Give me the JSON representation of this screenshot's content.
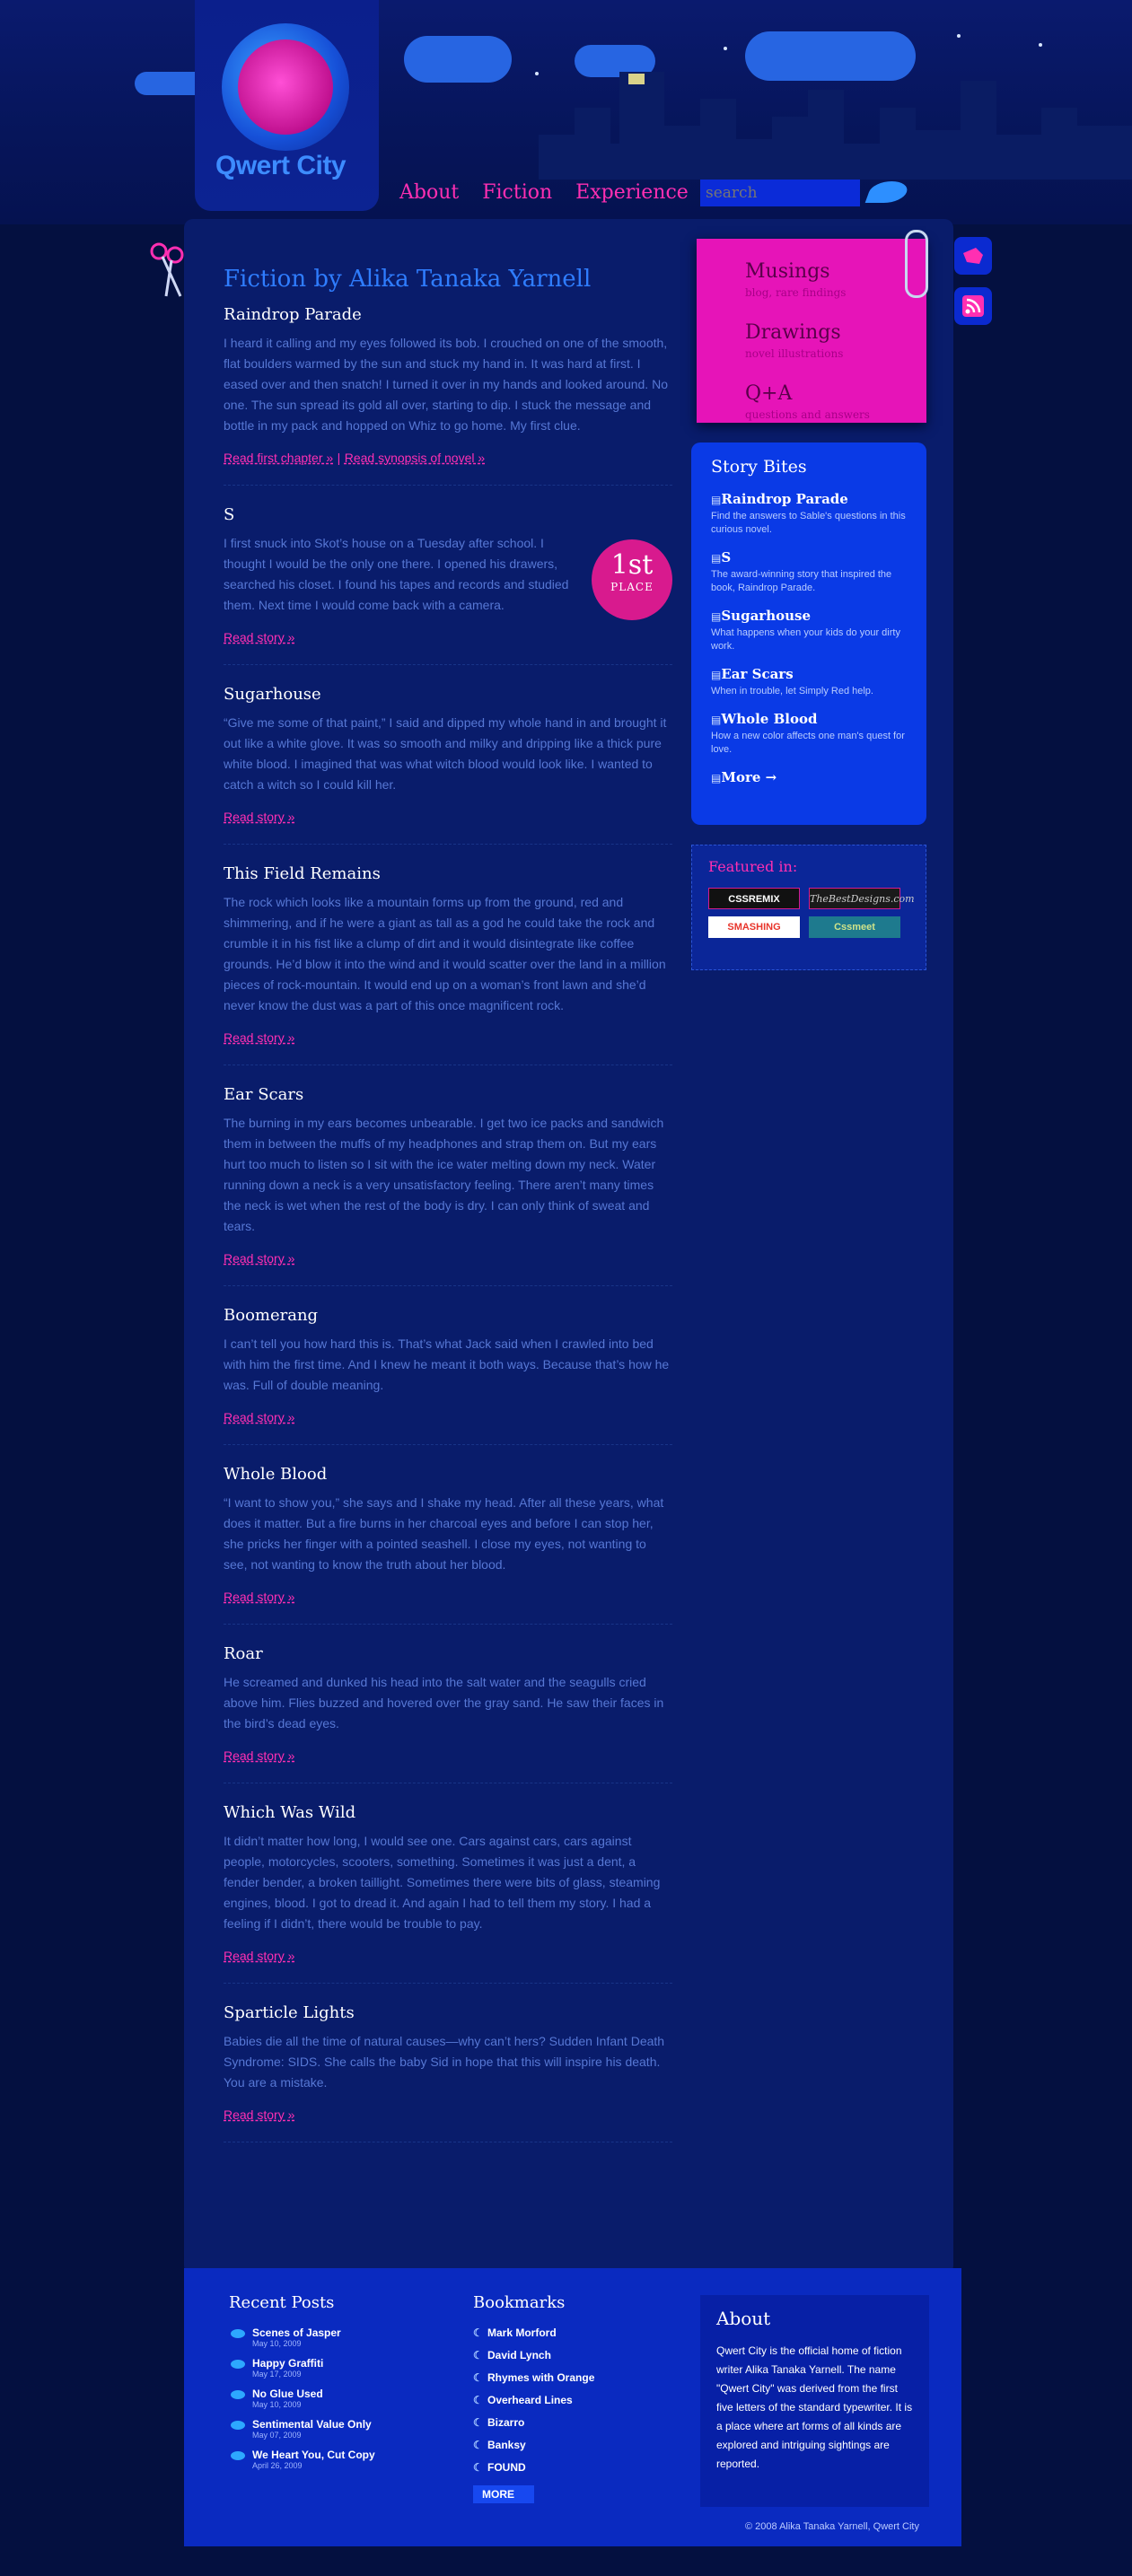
{
  "site": {
    "logo_text": "Qwert City"
  },
  "nav": {
    "items": [
      "About",
      "Fiction",
      "Experience"
    ],
    "search_placeholder": "search"
  },
  "page": {
    "title": "Fiction by Alika Tanaka Yarnell"
  },
  "stories": [
    {
      "title": "Raindrop Parade",
      "text": "I heard it calling and my eyes followed its bob. I crouched on one of the smooth, flat boulders warmed by the sun and stuck my hand in. It was hard at first. I eased over and then snatch! I turned it over in my hands and looked around. No one. The sun spread its gold all over, starting to dip. I stuck the message and bottle in my pack and hopped on Whiz to go home. My first clue.",
      "link": "Read first chapter »",
      "link2": "Read synopsis of novel »"
    },
    {
      "title": "S",
      "text": "I first snuck into Skot’s house on a Tuesday after school. I thought I would be the only one there. I opened his drawers, searched his closet. I found his tapes and records and studied them. Next time I would come back with a camera.",
      "link": "Read story »",
      "badge_big": "1st",
      "badge_small": "PLACE"
    },
    {
      "title": "Sugarhouse",
      "text": "“Give me some of that paint,” I said and dipped my whole hand in and brought it out like a white glove. It was so smooth and milky and dripping like a thick pure white blood. I imagined that was what witch blood would look like. I wanted to catch a witch so I could kill her.",
      "link": "Read story »"
    },
    {
      "title": "This Field Remains",
      "text": "The rock which looks like a mountain forms up from the ground, red and shimmering, and if he were a giant as tall as a god he could take the rock and crumble it in his fist like a clump of dirt and it would disintegrate like coffee grounds. He’d blow it into the wind and it would scatter over the land in a million pieces of rock-mountain. It would end up on a woman’s front lawn and she’d never know the dust was a part of this once magnificent rock.",
      "link": "Read story »"
    },
    {
      "title": "Ear Scars",
      "text": "The burning in my ears becomes unbearable. I get two ice packs and sandwich them in between the muffs of my headphones and strap them on. But my ears hurt too much to listen so I sit with the ice water melting down my neck. Water running down a neck is a very unsatisfactory feeling. There aren’t many times the neck is wet when the rest of the body is dry. I can only think of sweat and tears.",
      "link": "Read story »"
    },
    {
      "title": "Boomerang",
      "text": "I can’t tell you how hard this is. That’s what Jack said when I crawled into bed with him the first time. And I knew he meant it both ways. Because that’s how he was. Full of double meaning.",
      "link": "Read story »"
    },
    {
      "title": "Whole Blood",
      "text": "“I want to show you,” she says and I shake my head. After all these years, what does it matter. But a fire burns in her charcoal eyes and before I can stop her, she pricks her finger with a pointed seashell. I close my eyes, not wanting to see, not wanting to know the truth about her blood.",
      "link": "Read story »"
    },
    {
      "title": "Roar",
      "text": "He screamed and dunked his head into the salt water and the seagulls cried above him. Flies buzzed and hovered over the gray sand. He saw their faces in the bird’s dead eyes.",
      "link": "Read story »"
    },
    {
      "title": "Which Was Wild",
      "text": "It didn’t matter how long, I would see one. Cars against cars, cars against people, motorcycles, scooters, something. Sometimes it was just a dent, a fender bender, a broken taillight. Sometimes there were bits of glass, steaming engines, blood. I got to dread it. And again I had to tell them my story. I had a feeling if I didn’t, there would be trouble to pay.",
      "link": "Read story »"
    },
    {
      "title": "Sparticle Lights",
      "text": "Babies die all the time of natural causes—why can’t hers? Sudden Infant Death Syndrome: SIDS. She calls the baby Sid in hope that this will inspire his death. You are a mistake.",
      "link": "Read story »"
    }
  ],
  "sticky_note": [
    {
      "title": "Musings",
      "sub": "blog, rare findings"
    },
    {
      "title": "Drawings",
      "sub": "novel illustrations"
    },
    {
      "title": "Q+A",
      "sub": "questions and answers"
    }
  ],
  "story_bites": {
    "heading": "Story Bites",
    "items": [
      {
        "title": "Raindrop Parade",
        "desc": "Find the answers to Sable's questions in this curious novel."
      },
      {
        "title": "S",
        "desc": "The award-winning story that inspired the book, Raindrop Parade."
      },
      {
        "title": "Sugarhouse",
        "desc": "What happens when your kids do your dirty work."
      },
      {
        "title": "Ear Scars",
        "desc": "When in trouble, let Simply Red help."
      },
      {
        "title": "Whole Blood",
        "desc": "How a new color affects one man's quest for love."
      }
    ],
    "more": "More →"
  },
  "featured": {
    "heading": "Featured in:",
    "logos": [
      "CSSREMIX",
      "TheBestDesigns.com",
      "SMASHING",
      "Cssmeet"
    ]
  },
  "footer": {
    "recent_heading": "Recent Posts",
    "recent": [
      {
        "title": "Scenes of Jasper",
        "date": "May 10, 2009"
      },
      {
        "title": "Happy Graffiti",
        "date": "May 17, 2009"
      },
      {
        "title": "No Glue Used",
        "date": "May 10, 2009"
      },
      {
        "title": "Sentimental Value Only",
        "date": "May 07, 2009"
      },
      {
        "title": "We Heart You, Cut Copy",
        "date": "April 26, 2009"
      }
    ],
    "bookmarks_heading": "Bookmarks",
    "bookmarks": [
      "Mark Morford",
      "David Lynch",
      "Rhymes with Orange",
      "Overheard Lines",
      "Bizarro",
      "Banksy",
      "FOUND"
    ],
    "more": "MORE",
    "about_heading": "About",
    "about_text": "Qwert City is the official home of fiction writer Alika Tanaka Yarnell. The name \"Qwert City\" was derived from the first five letters of the standard typewriter. It is a place where art forms of all kinds are explored and intriguing sightings are reported.",
    "copyright": "© 2008 Alika Tanaka Yarnell, Qwert City"
  }
}
